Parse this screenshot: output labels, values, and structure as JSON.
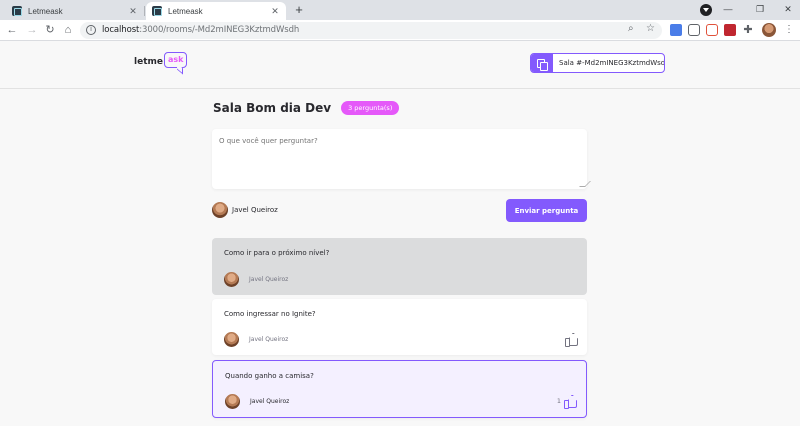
{
  "browser": {
    "tabs": [
      {
        "title": "Letmeask",
        "active": false
      },
      {
        "title": "Letmeask",
        "active": true
      }
    ],
    "new_tab": "+",
    "url_host": "localhost",
    "url_rest": ":3000/rooms/-Md2mINEG3KztmdWsdh"
  },
  "header": {
    "logo_part1": "letme",
    "logo_part2": "ask",
    "room_code_label": "Sala #-Md2mINEG3KztmdWsdh"
  },
  "room": {
    "title": "Sala Bom dia Dev",
    "question_count": "3 pergunta(s)"
  },
  "form": {
    "placeholder": "O que você quer perguntar?",
    "user_name": "Javel Queiroz",
    "submit_label": "Enviar pergunta"
  },
  "questions": [
    {
      "text": "Como ir para o próximo nível?",
      "author": "Javel Queiroz",
      "state": "answered",
      "likes": ""
    },
    {
      "text": "Como ingressar no Ignite?",
      "author": "Javel Queiroz",
      "state": "normal",
      "likes": ""
    },
    {
      "text": "Quando ganho a camisa?",
      "author": "Javel Queiroz",
      "state": "highlighted",
      "likes": "1"
    }
  ],
  "colors": {
    "primary": "#835afd",
    "pink": "#e559f9",
    "answered_bg": "#dbdcdd",
    "highlight_bg": "#f4f0ff"
  }
}
